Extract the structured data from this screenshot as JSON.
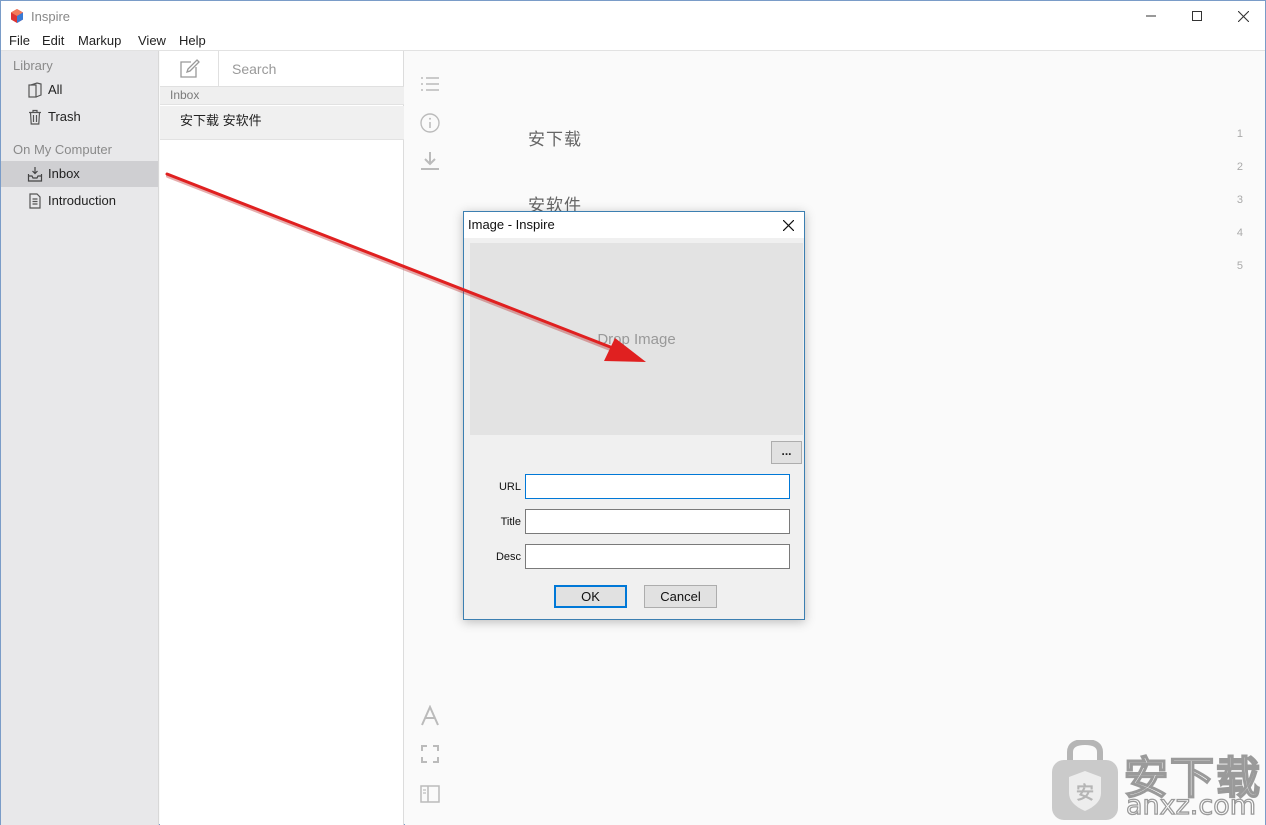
{
  "app": {
    "title": "Inspire"
  },
  "menu": [
    "File",
    "Edit",
    "Markup",
    "View",
    "Help"
  ],
  "sidebar": {
    "library_heading": "Library",
    "library_items": [
      {
        "label": "All",
        "icon": "books-icon"
      },
      {
        "label": "Trash",
        "icon": "trash-icon"
      }
    ],
    "computer_heading": "On My Computer",
    "computer_items": [
      {
        "label": "Inbox",
        "icon": "inbox-icon",
        "selected": true
      },
      {
        "label": "Introduction",
        "icon": "document-icon",
        "selected": false
      }
    ]
  },
  "notelist": {
    "search_placeholder": "Search",
    "group_label": "Inbox",
    "notes": [
      "安下载 安软件"
    ]
  },
  "editor": {
    "lines": [
      "安下载",
      "安软件"
    ],
    "line_numbers": [
      "1",
      "2",
      "3",
      "4",
      "5"
    ]
  },
  "dialog": {
    "title": "Image - Inspire",
    "drop_text": "Drop Image",
    "browse_label": "...",
    "fields": [
      {
        "label": "URL",
        "value": ""
      },
      {
        "label": "Title",
        "value": ""
      },
      {
        "label": "Desc",
        "value": ""
      }
    ],
    "ok_label": "OK",
    "cancel_label": "Cancel"
  },
  "annotation": {
    "arrow_color": "#e02020"
  },
  "watermark": {
    "zh": "安下载",
    "en": "anxz.com"
  }
}
